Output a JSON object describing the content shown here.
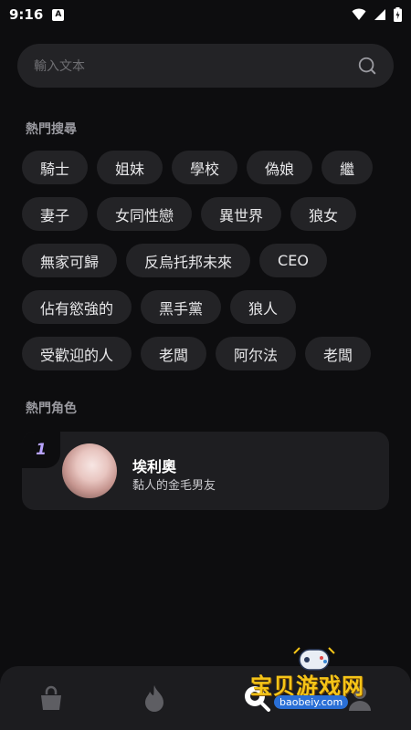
{
  "status": {
    "time": "9:16",
    "notification_letter": "A"
  },
  "search": {
    "placeholder": "輸入文本"
  },
  "hot_search": {
    "title": "熱門搜尋",
    "tags": [
      "騎士",
      "姐妹",
      "學校",
      "偽娘",
      "繼",
      "妻子",
      "女同性戀",
      "異世界",
      "狼女",
      "無家可歸",
      "反烏托邦未來",
      "CEO",
      "佔有慾強的",
      "黑手黨",
      "狼人",
      "受歡迎的人",
      "老闆",
      "阿尔法",
      "老闆"
    ]
  },
  "hot_characters": {
    "title": "熱門角色",
    "items": [
      {
        "rank": "1",
        "name": "埃利奧",
        "description": "黏人的金毛男友"
      }
    ]
  },
  "bottom_nav": {
    "items": [
      "bag-icon",
      "flame-icon",
      "discover-icon",
      "profile-icon"
    ],
    "active": "discover-icon"
  },
  "watermark": {
    "main": "宝贝游戏网",
    "sub": "baobeiy.com"
  }
}
